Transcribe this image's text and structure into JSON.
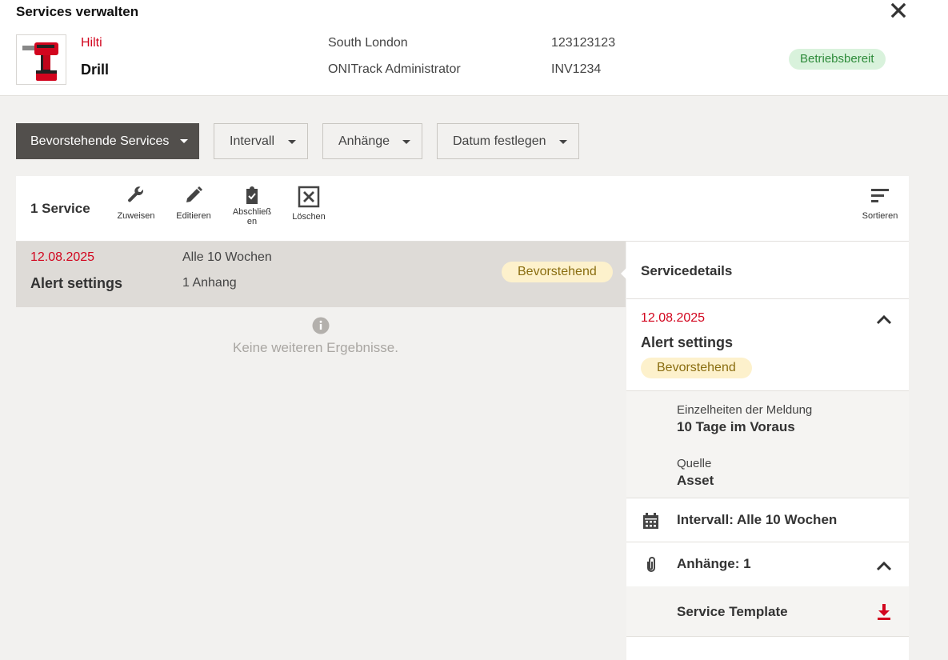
{
  "header": {
    "title": "Services verwalten",
    "brand": "Hilti",
    "product": "Drill",
    "location": "South London",
    "owner": "ONITrack Administrator",
    "serial": "123123123",
    "inventory": "INV1234",
    "status": "Betriebsbereit"
  },
  "filters": {
    "services": "Bevorstehende Services",
    "interval": "Intervall",
    "attachments": "Anhänge",
    "date": "Datum festlegen"
  },
  "toolbar": {
    "count": "1 Service",
    "assign": "Zuweisen",
    "edit": "Editieren",
    "complete_line1": "Abschließ",
    "complete_line2": "en",
    "delete": "Löschen",
    "sort": "Sortieren"
  },
  "list": {
    "rows": [
      {
        "date": "12.08.2025",
        "name": "Alert settings",
        "interval": "Alle 10 Wochen",
        "attachments": "1 Anhang",
        "status": "Bevorstehend"
      }
    ],
    "no_results": "Keine weiteren Ergebnisse."
  },
  "details": {
    "title": "Servicedetails",
    "date": "12.08.2025",
    "name": "Alert settings",
    "status": "Bevorstehend",
    "notice_label": "Einzelheiten der Meldung",
    "notice_value": "10 Tage im Voraus",
    "source_label": "Quelle",
    "source_value": "Asset",
    "interval": "Intervall: Alle 10 Wochen",
    "attachments": "Anhänge: 1",
    "template": "Service Template"
  },
  "colors": {
    "accent_red": "#d2051e",
    "dark_button": "#524f4c",
    "success_bg": "#d9f2dc",
    "warning_bg": "#fdf1cc"
  }
}
